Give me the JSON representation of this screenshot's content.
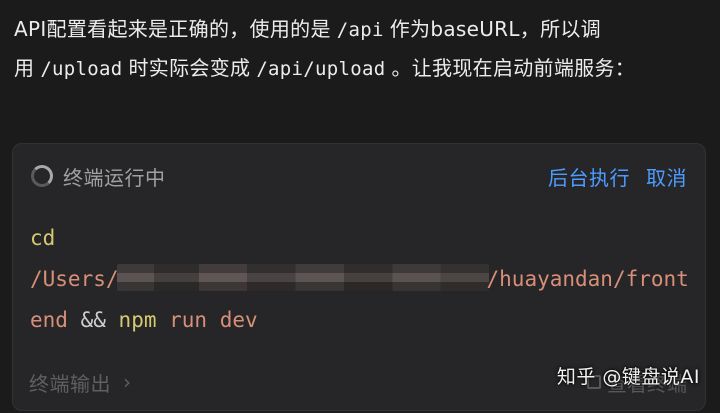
{
  "message": {
    "part1": "API配置看起来是正确的，使用的是",
    "code1": "/api",
    "part2": "作为baseURL，所以调用",
    "code2": "/upload",
    "part3": "时实际会变成",
    "code3": "/api/upload",
    "part4": "。让我现在启动前端服务："
  },
  "terminal": {
    "status": "终端运行中",
    "background_label": "后台执行",
    "cancel_label": "取消",
    "command": {
      "cmd1": "cd",
      "path_prefix": "/Users/",
      "path_suffix": "/huayandan/frontend",
      "op": "&&",
      "cmd2": "npm",
      "args": "run dev"
    },
    "output_label": "终端输出",
    "view_label": "查看终端"
  },
  "watermark": "知乎 @键盘说AI",
  "colors": {
    "background": "#1b1b1c",
    "card": "#262628",
    "accent_blue": "#4d9cff",
    "cmd_yellow": "#d6c96f",
    "path_orange": "#d88f78"
  },
  "icons": {
    "spinner": "loading-spinner-icon",
    "chevron": "chevron-right-icon",
    "expand": "expand-terminal-icon"
  }
}
